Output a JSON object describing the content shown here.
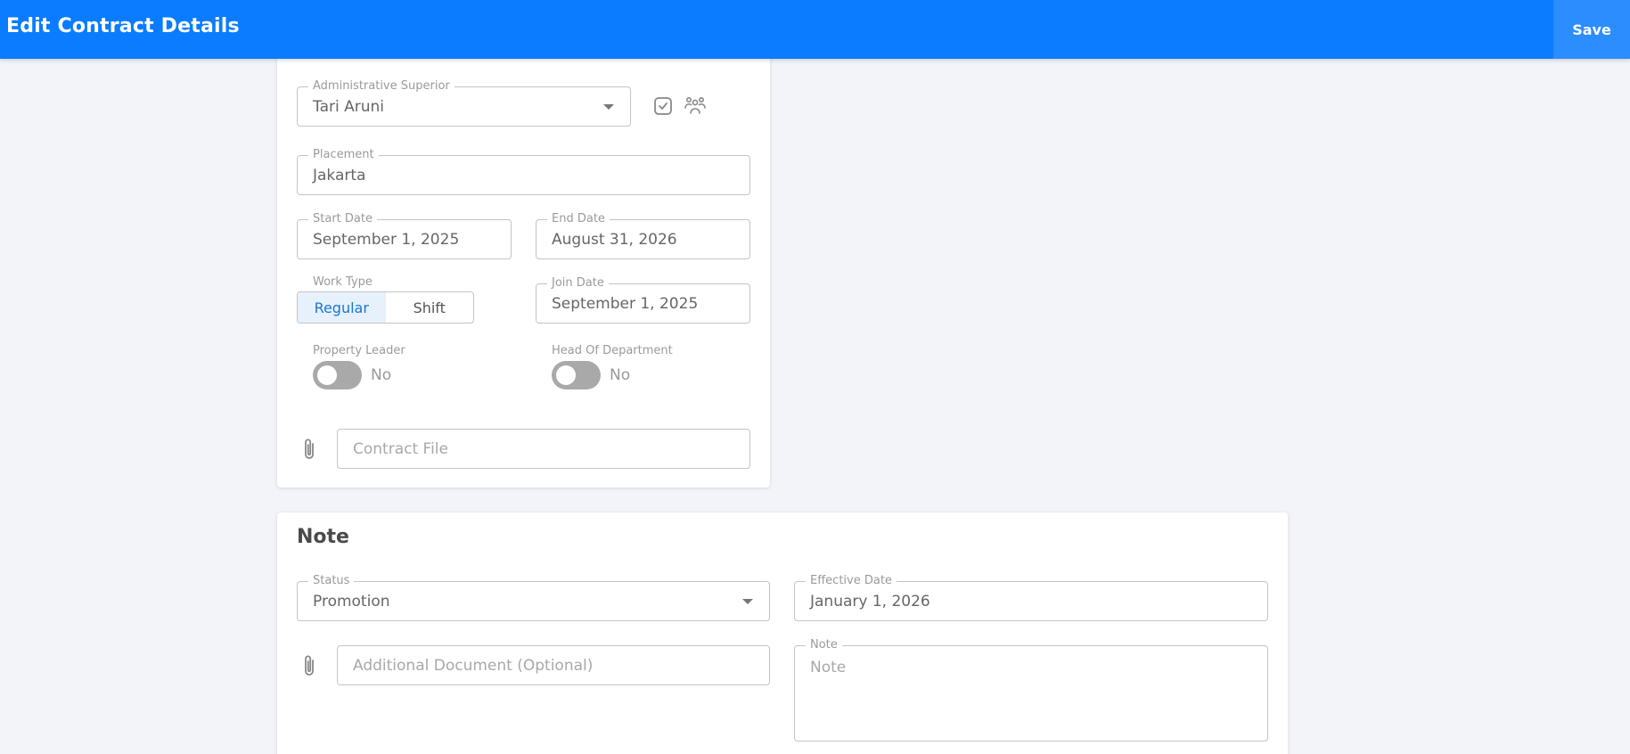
{
  "header": {
    "title": "Edit Contract Details",
    "save_label": "Save",
    "accent": "#0a7cff"
  },
  "contract": {
    "admin_superior": {
      "label": "Administrative Superior",
      "value": "Tari Aruni"
    },
    "placement": {
      "label": "Placement",
      "value": "Jakarta"
    },
    "start_date": {
      "label": "Start Date",
      "value": "September 1, 2025"
    },
    "end_date": {
      "label": "End Date",
      "value": "August 31, 2026"
    },
    "work_type": {
      "label": "Work Type",
      "options": [
        "Regular",
        "Shift"
      ],
      "selected": "Regular"
    },
    "join_date": {
      "label": "Join Date",
      "value": "September 1, 2025"
    },
    "property_leader": {
      "label": "Property Leader",
      "state": "No"
    },
    "head_of_department": {
      "label": "Head Of Department",
      "state": "No"
    },
    "contract_file": {
      "placeholder": "Contract File"
    }
  },
  "note_section": {
    "title": "Note",
    "status": {
      "label": "Status",
      "value": "Promotion"
    },
    "effective_date": {
      "label": "Effective Date",
      "value": "January 1, 2026"
    },
    "additional_document": {
      "placeholder": "Additional Document (Optional)"
    },
    "note": {
      "label": "Note",
      "placeholder": "Note"
    }
  },
  "icons": {
    "checkbox": "check-square-icon",
    "users": "users-group-icon",
    "attach": "paperclip-icon"
  }
}
